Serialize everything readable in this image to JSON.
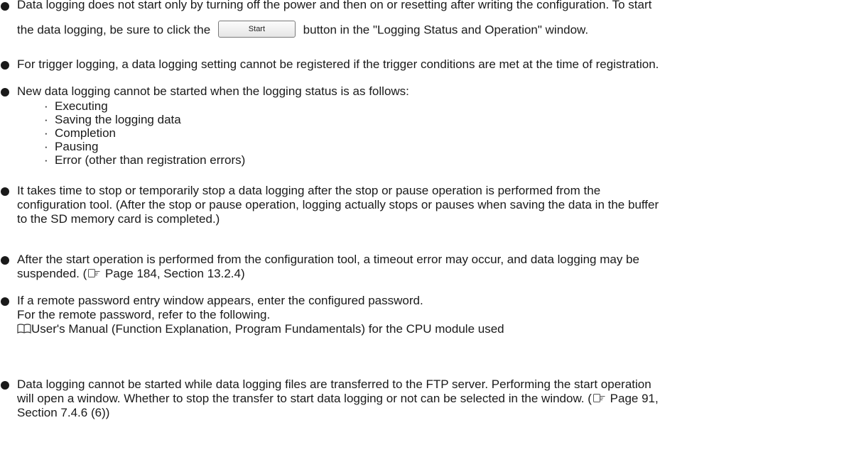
{
  "notes": {
    "n1": {
      "line1": "Data logging does not start only by turning off the power and then on or resetting after writing the configuration. To start",
      "line2_pre": "the data logging, be sure to click the",
      "button_label": "Start",
      "line2_post": "button in the \"Logging Status and Operation\" window."
    },
    "n2": {
      "line1": "For trigger logging, a data logging setting cannot be registered if the trigger conditions are met at the time of registration."
    },
    "n3": {
      "line1": "New data logging cannot be started when the logging status is as follows:",
      "items": [
        "Executing",
        "Saving the logging data",
        "Completion",
        "Pausing",
        "Error (other than registration errors)"
      ]
    },
    "n4": {
      "line1": "It takes time to stop or temporarily stop a data logging after the stop or pause operation is performed from the",
      "line2": "configuration tool. (After the stop or pause operation, logging actually stops or pauses when saving the data in the buffer",
      "line3": "to the SD memory card is completed.)"
    },
    "n5": {
      "line1": "After the start operation is performed from the configuration tool, a timeout error may occur, and data logging may be",
      "line2_pre": "suspended. (",
      "line2_ref": "Page 184, Section 13.2.4)"
    },
    "n6": {
      "line1": "If a remote password entry window appears, enter the configured password.",
      "line2": "For the remote password, refer to the following.",
      "line3": "User's Manual (Function Explanation, Program Fundamentals) for the CPU module used"
    },
    "n7": {
      "line1": "Data logging cannot be started while data logging files are transferred to the FTP server. Performing the start operation",
      "line2_pre": "will open a window. Whether to stop the transfer to start data logging or not can be selected in the window. (",
      "line2_ref": "Page 91,",
      "line3": "Section 7.4.6 (6))"
    }
  },
  "icons": {
    "bullet": "filled-circle",
    "reference": "pointing-hand-icon",
    "manual": "open-book-icon"
  }
}
